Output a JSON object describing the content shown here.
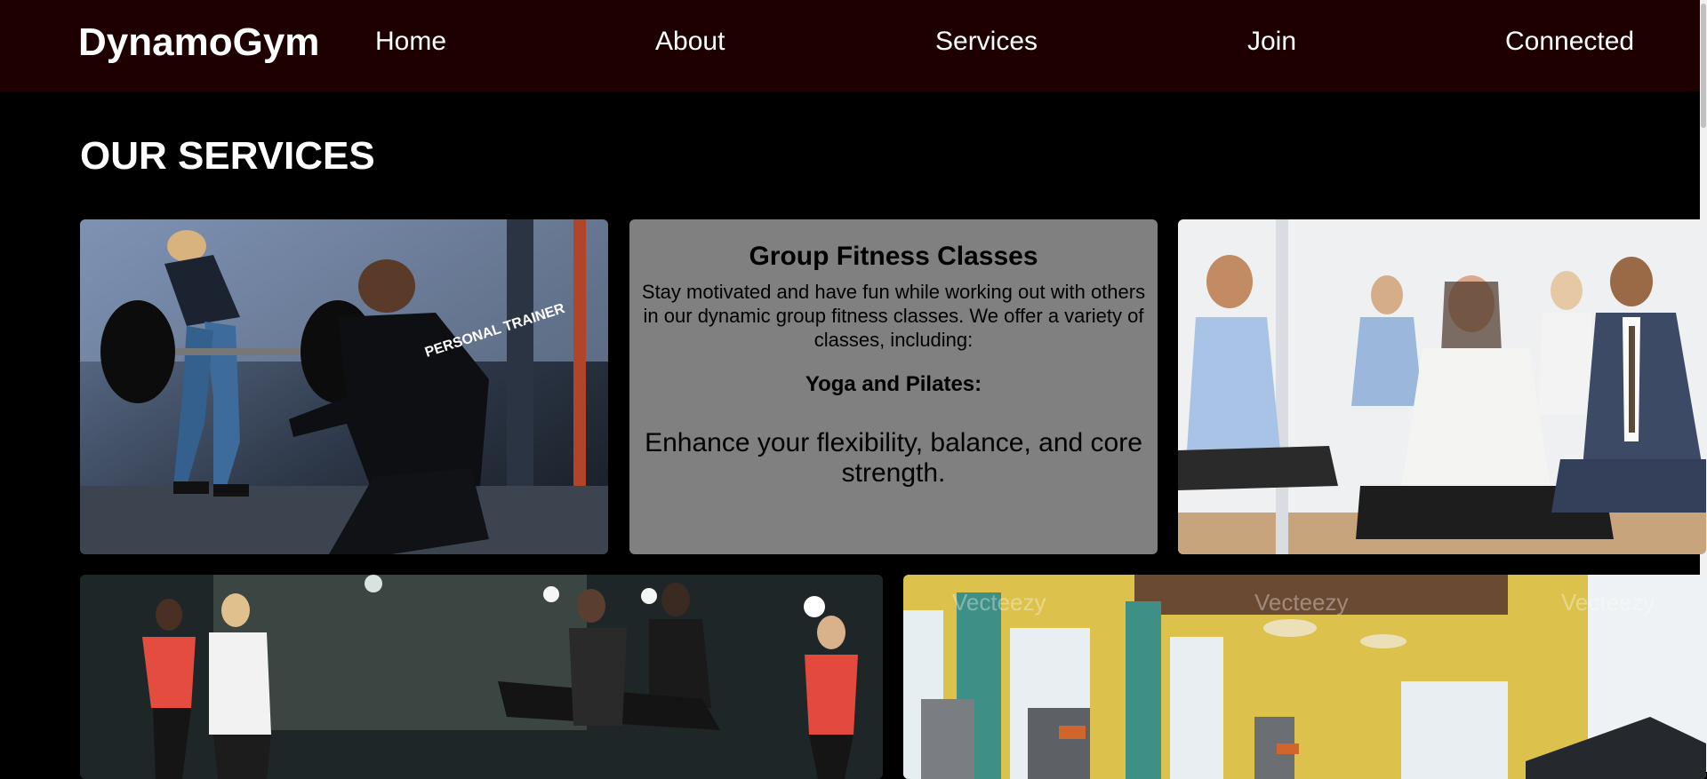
{
  "nav": {
    "brand": "DynamoGym",
    "links": [
      "Home",
      "About",
      "Services",
      "Join",
      "Connected"
    ]
  },
  "services": {
    "title": "OUR SERVICES",
    "feature_card": {
      "heading": "Group Fitness Classes",
      "description": "Stay motivated and have fun while working out with others in our dynamic group fitness classes. We offer a variety of classes, including:",
      "subheading": "Yoga and Pilates:",
      "detail": "Enhance your flexibility, balance, and core strength."
    },
    "images": {
      "personal_trainer_shirt": "PERSONAL TRAINER",
      "watermark": "Vecteezy"
    }
  },
  "colors": {
    "navbar_bg": "#1e0001",
    "page_bg": "#000000",
    "card_bg": "#808080"
  }
}
